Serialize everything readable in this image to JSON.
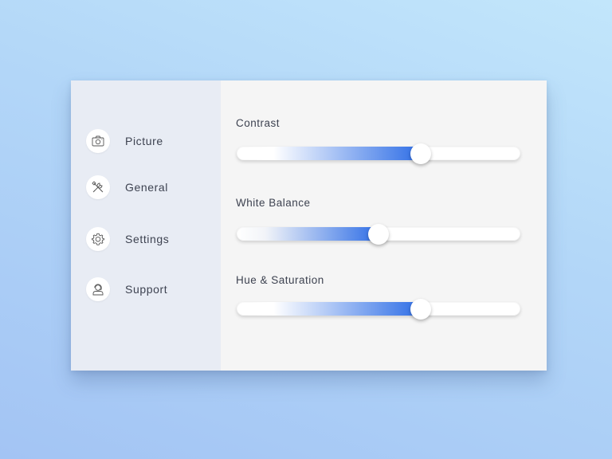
{
  "sidebar": {
    "items": [
      {
        "label": "Picture",
        "icon": "camera-icon"
      },
      {
        "label": "General",
        "icon": "tools-icon"
      },
      {
        "label": "Settings",
        "icon": "gear-icon"
      },
      {
        "label": "Support",
        "icon": "support-agent-icon"
      }
    ]
  },
  "sliders": [
    {
      "label": "Contrast",
      "value_percent": 65,
      "gradient": [
        "#ffffff",
        "#2f6ee6"
      ]
    },
    {
      "label": "White Balance",
      "value_percent": 50,
      "gradient": [
        "#f2f4f8",
        "#2f6ee6"
      ]
    },
    {
      "label": "Hue & Saturation",
      "value_percent": 65,
      "gradient": [
        "#ffffff",
        "#2f6ee6"
      ]
    }
  ],
  "colors": {
    "accent": "#2f6ee6",
    "sidebar_bg": "#e8ecf4",
    "content_bg": "#f5f5f5"
  }
}
